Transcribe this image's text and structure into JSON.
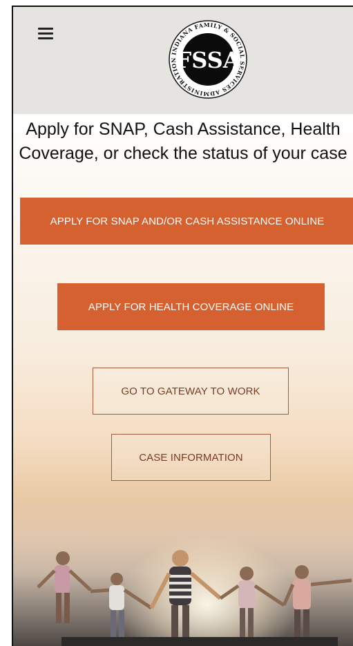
{
  "header": {
    "menu_icon": "hamburger-menu-icon",
    "logo": {
      "icon": "fssa-seal-logo",
      "ring_text": "INDIANA FAMILY & SOCIAL SERVICES ADMINISTRATION",
      "monogram": "FSSA"
    }
  },
  "main": {
    "headline_line1": "Apply for SNAP, Cash Assistance, Health",
    "headline_line2": "Coverage, or check the status of your case",
    "buttons": {
      "apply_snap": "APPLY FOR SNAP AND/OR CASH ASSISTANCE ONLINE",
      "apply_health": "APPLY FOR HEALTH COVERAGE ONLINE",
      "gateway": "GO TO GATEWAY TO WORK",
      "case_info": "CASE INFORMATION"
    }
  },
  "colors": {
    "primary_button": "#d56131",
    "outline_border": "#a45a3d",
    "header_bg": "#e6e4e1"
  }
}
